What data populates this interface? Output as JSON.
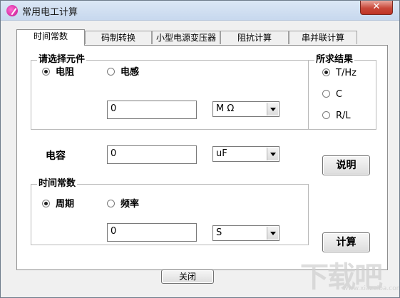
{
  "window": {
    "title": "常用电工计算",
    "close_glyph": "✕"
  },
  "tabs": [
    {
      "label": "时间常数",
      "active": true
    },
    {
      "label": "码制转换",
      "active": false
    },
    {
      "label": "小型电源变压器",
      "active": false
    },
    {
      "label": "阻抗计算",
      "active": false
    },
    {
      "label": "串并联计算",
      "active": false
    }
  ],
  "component_group": {
    "title": "请选择元件",
    "options": [
      {
        "label": "电阻",
        "selected": true
      },
      {
        "label": "电感",
        "selected": false
      }
    ],
    "value": "0",
    "unit": "M Ω"
  },
  "capacitance": {
    "label": "电容",
    "value": "0",
    "unit": "uF"
  },
  "result_group": {
    "title": "所求结果",
    "options": [
      {
        "label": "T/Hz",
        "selected": true
      },
      {
        "label": "C",
        "selected": false
      },
      {
        "label": "R/L",
        "selected": false
      }
    ]
  },
  "time_constant_group": {
    "title": "时间常数",
    "options": [
      {
        "label": "周期",
        "selected": true
      },
      {
        "label": "频率",
        "selected": false
      }
    ],
    "value": "0",
    "unit": "S"
  },
  "buttons": {
    "explain": "说明",
    "calculate": "计算",
    "close": "关闭"
  },
  "watermark": {
    "main": "下载吧",
    "sub": "www.xiazaiba.com"
  }
}
